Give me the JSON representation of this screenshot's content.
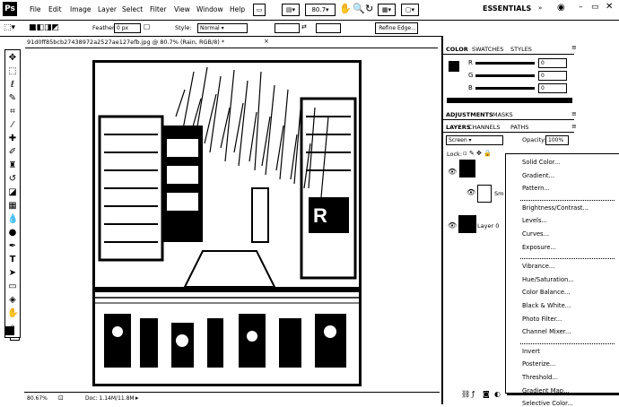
{
  "app": {
    "logo": "Ps",
    "zoom_value": "80.7",
    "workspace": "ESSENTIALS"
  },
  "menu": {
    "items": [
      "File",
      "Edit",
      "Image",
      "Layer",
      "Select",
      "Filter",
      "View",
      "Window",
      "Help"
    ]
  },
  "options": {
    "feather_label": "Feather:",
    "feather_value": "0 px",
    "style_label": "Style:",
    "style_value": "Normal",
    "refine_edge": "Refine Edge..."
  },
  "document": {
    "tab_title": "91d0ff85bcb27438972a2527ae127efb.jpg @ 80.7% (Rain, RGB/8) *",
    "status_zoom": "80.67%",
    "status_doc": "Doc: 1.14M/11.8M"
  },
  "panels": {
    "color_tabs": [
      "COLOR",
      "SWATCHES",
      "STYLES"
    ],
    "color_channels": [
      "R",
      "G",
      "B"
    ],
    "color_values": [
      "0",
      "0",
      "0"
    ],
    "adjust_tabs": [
      "ADJUSTMENTS",
      "MASKS"
    ],
    "layer_tabs": [
      "LAYERS",
      "CHANNELS",
      "PATHS"
    ],
    "blend_mode": "Screen",
    "opacity_label": "Opacity:",
    "opacity_value": "100%",
    "lock_label": "Lock:",
    "layers": [
      {
        "name": "Sm"
      },
      {
        "name": "Layer 0"
      }
    ]
  },
  "dropdown": {
    "groups": [
      [
        "Solid Color...",
        "Gradient...",
        "Pattern..."
      ],
      [
        "Brightness/Contrast...",
        "Levels...",
        "Curves...",
        "Exposure..."
      ],
      [
        "Vibrance...",
        "Hue/Saturation...",
        "Color Balance...",
        "Black & White...",
        "Photo Filter...",
        "Channel Mixer..."
      ],
      [
        "Invert",
        "Posterize...",
        "Threshold...",
        "Gradient Map...",
        "Selective Color..."
      ]
    ]
  }
}
